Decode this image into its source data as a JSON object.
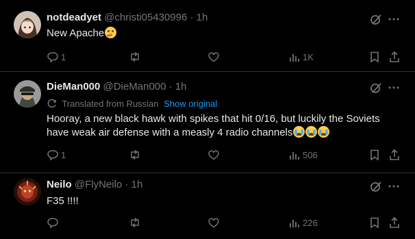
{
  "colors": {
    "background": "#000000",
    "text": "#e7e9ea",
    "muted": "#71767b",
    "link": "#1d9bf0",
    "divider": "#2f3336"
  },
  "posts": [
    {
      "name": "notdeadyet",
      "handle": "@christi05430996",
      "time": "· 1h",
      "text": "New Apache",
      "emoji": [
        "thinking-face"
      ],
      "replies": "1",
      "views": "1K",
      "avatar": "anime-character-avatar"
    },
    {
      "name": "DieMan000",
      "handle": "@DieMan000",
      "time": "· 1h",
      "translated_label": "Translated from Russian",
      "show_original": "Show original",
      "text": "Hooray, a new black hawk with spikes that hit 0/16, but luckily the Soviets have weak air defense with a measly 4 radio channels",
      "emoji": [
        "loudly-crying-face",
        "loudly-crying-face",
        "loudly-crying-face"
      ],
      "replies": "1",
      "views": "506",
      "avatar": "soldier-avatar"
    },
    {
      "name": "Neilo",
      "handle": "@FlyNeilo",
      "time": "· 1h",
      "text": "F35 !!!!",
      "emoji": [],
      "replies": "",
      "views": "226",
      "avatar": "red-character-avatar"
    }
  ]
}
